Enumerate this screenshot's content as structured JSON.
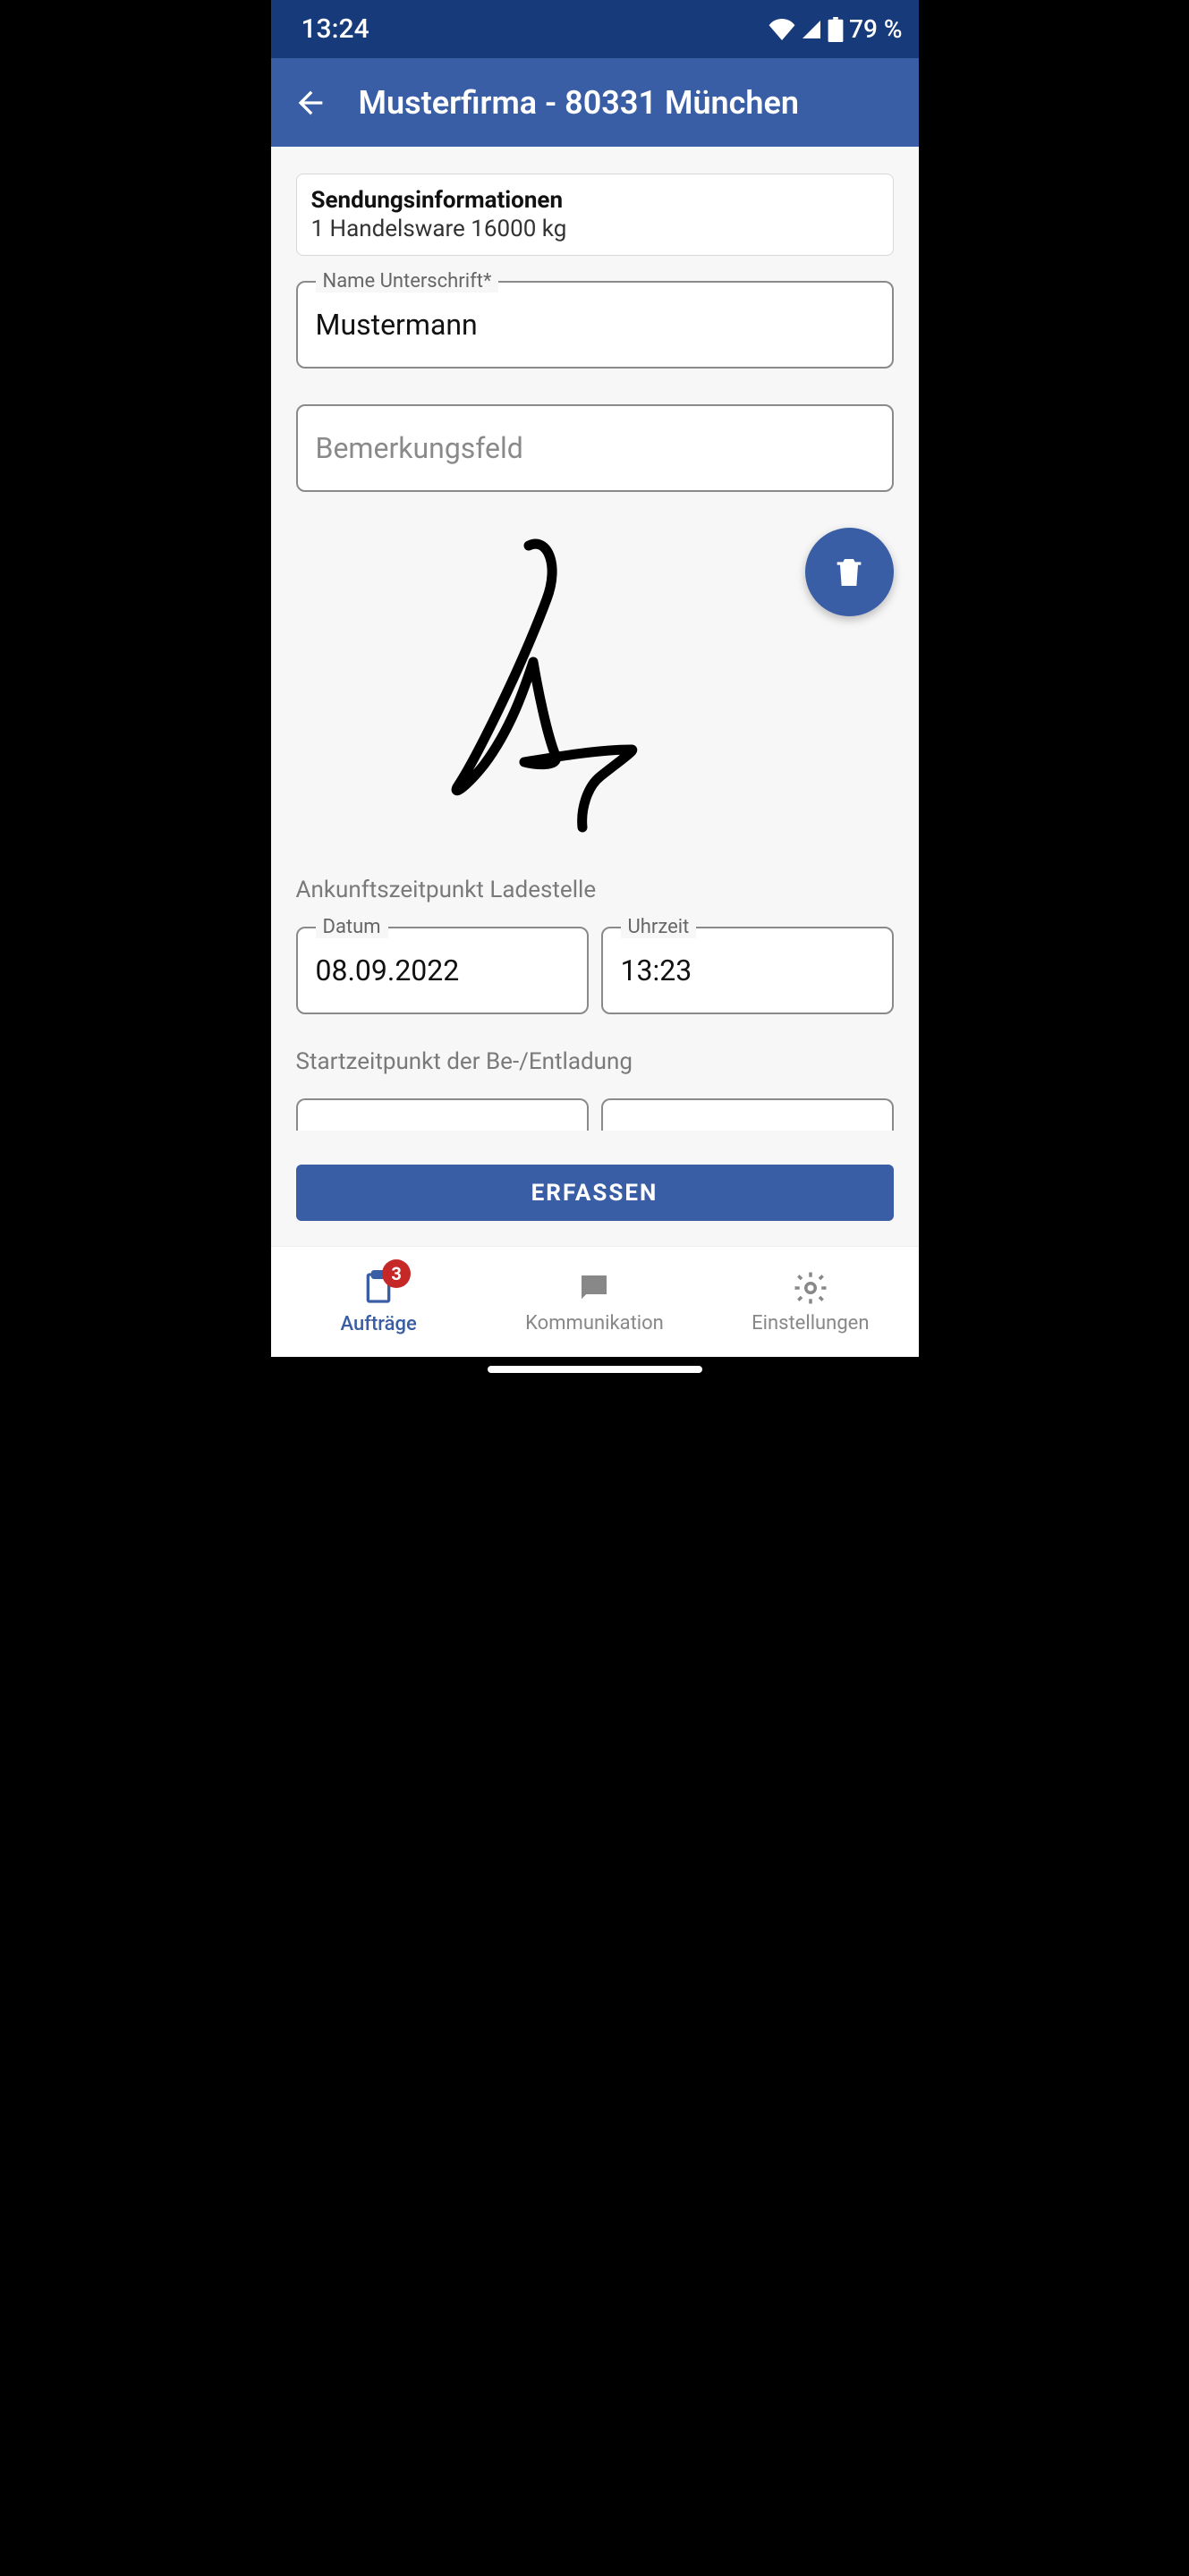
{
  "status": {
    "time": "13:24",
    "battery": "79 %"
  },
  "header": {
    "title": "Musterfirma - 80331 München"
  },
  "card": {
    "title": "Sendungsinformationen",
    "subtitle": "1 Handelsware 16000 kg"
  },
  "fields": {
    "name": {
      "label": "Name Unterschrift*",
      "value": "Mustermann"
    },
    "remark": {
      "placeholder": "Bemerkungsfeld",
      "value": ""
    }
  },
  "sections": {
    "arrival": {
      "label": "Ankunftszeitpunkt Ladestelle",
      "date": {
        "label": "Datum",
        "value": "08.09.2022"
      },
      "time": {
        "label": "Uhrzeit",
        "value": "13:23"
      }
    },
    "start": {
      "label": "Startzeitpunkt der Be-/Entladung"
    }
  },
  "button": {
    "submit": "ERFASSEN"
  },
  "nav": {
    "items": [
      {
        "label": "Aufträge",
        "badge": "3"
      },
      {
        "label": "Kommunikation"
      },
      {
        "label": "Einstellungen"
      }
    ]
  }
}
